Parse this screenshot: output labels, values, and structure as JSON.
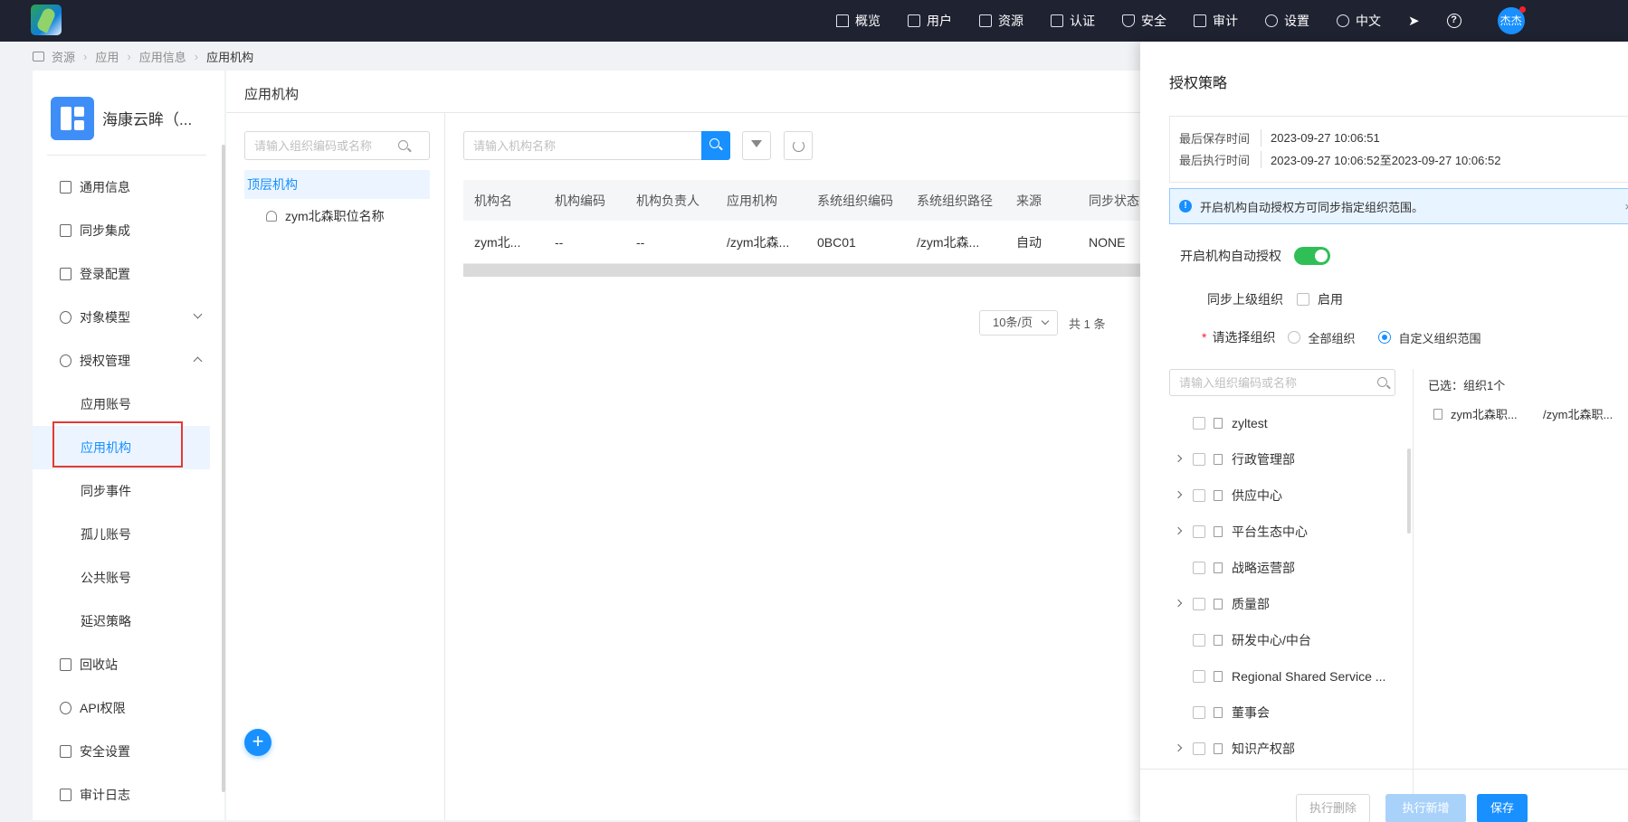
{
  "topbar": {
    "nav": [
      {
        "label": "概览",
        "icon": "home-icon"
      },
      {
        "label": "用户",
        "icon": "user-icon"
      },
      {
        "label": "资源",
        "icon": "folder-icon"
      },
      {
        "label": "认证",
        "icon": "monitor-icon"
      },
      {
        "label": "安全",
        "icon": "shield-icon"
      },
      {
        "label": "审计",
        "icon": "audit-icon"
      },
      {
        "label": "设置",
        "icon": "gear-icon"
      },
      {
        "label": "中文",
        "icon": "globe-icon"
      }
    ],
    "help": "?",
    "avatar": "杰杰"
  },
  "breadcrumb": [
    "资源",
    "应用",
    "应用信息",
    "应用机构"
  ],
  "leftnav": {
    "app_name": "海康云眸（...",
    "menu": [
      {
        "label": "通用信息"
      },
      {
        "label": "同步集成"
      },
      {
        "label": "登录配置"
      },
      {
        "label": "对象模型"
      },
      {
        "label": "授权管理"
      },
      {
        "label": "应用账号"
      },
      {
        "label": "应用机构"
      },
      {
        "label": "同步事件"
      },
      {
        "label": "孤儿账号"
      },
      {
        "label": "公共账号"
      },
      {
        "label": "延迟策略"
      },
      {
        "label": "回收站"
      },
      {
        "label": "API权限"
      },
      {
        "label": "安全设置"
      },
      {
        "label": "审计日志"
      }
    ]
  },
  "main": {
    "title": "应用机构",
    "tree_search_placeholder": "请输入组织编码或名称",
    "tree_top": "顶层机构",
    "tree_child": "zym北森职位名称",
    "search_placeholder": "请输入机构名称",
    "columns": [
      "机构名",
      "机构编码",
      "机构负责人",
      "应用机构",
      "系统组织编码",
      "系统组织路径",
      "来源",
      "同步状态"
    ],
    "rows": [
      [
        "zym北...",
        "--",
        "--",
        "/zym北森...",
        "0BC01",
        "/zym北森...",
        "自动",
        "NONE"
      ]
    ],
    "page_size": "10条/页",
    "total": "共 1 条",
    "fab": "+"
  },
  "drawer": {
    "title": "授权策略",
    "last_save_label": "最后保存时间",
    "last_save_value": "2023-09-27 10:06:51",
    "last_exec_label": "最后执行时间",
    "last_exec_value": "2023-09-27 10:06:52至2023-09-27 10:06:52",
    "alert": "开启机构自动授权方可同步指定组织范围。",
    "alert_close": "×",
    "auto_auth_label": "开启机构自动授权",
    "auto_auth_on": true,
    "sync_parent_label": "同步上级组织",
    "sync_parent_option": "启用",
    "required_mark": "*",
    "select_org_label": "请选择组织",
    "radio_all": "全部组织",
    "radio_custom": "自定义组织范围",
    "org_search_placeholder": "请输入组织编码或名称",
    "orgs": [
      {
        "label": "zyltest",
        "expandable": false
      },
      {
        "label": "行政管理部",
        "expandable": true
      },
      {
        "label": "供应中心",
        "expandable": true
      },
      {
        "label": "平台生态中心",
        "expandable": true
      },
      {
        "label": "战略运营部",
        "expandable": false
      },
      {
        "label": "质量部",
        "expandable": true
      },
      {
        "label": "研发中心/中台",
        "expandable": false
      },
      {
        "label": "Regional Shared Service ...",
        "expandable": false
      },
      {
        "label": "董事会",
        "expandable": false
      },
      {
        "label": "知识产权部",
        "expandable": true
      }
    ],
    "selected_count": "已选：组织1个",
    "selected": {
      "name": "zym北森职...",
      "path": "/zym北森职..."
    },
    "btn_delete": "执行删除",
    "btn_add": "执行新增",
    "btn_save": "保存"
  },
  "colors": {
    "accent": "#1890ff",
    "topbar": "#1f2231",
    "switch_on": "#2fbf56",
    "highlight": "#e53935"
  }
}
